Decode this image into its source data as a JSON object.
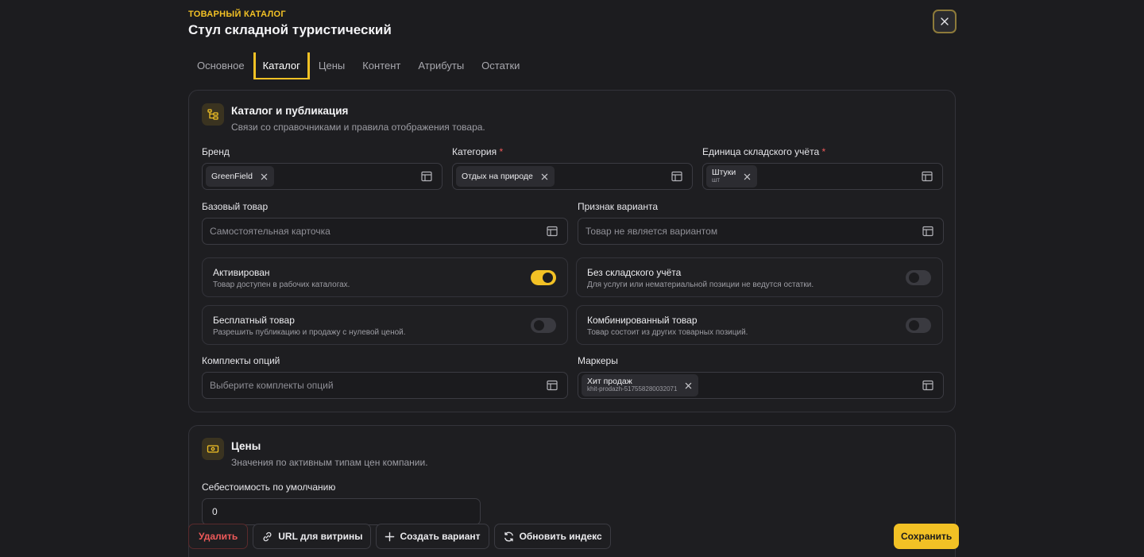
{
  "header": {
    "eyebrow": "ТОВАРНЫЙ КАТАЛОГ",
    "title": "Стул складной туристический"
  },
  "tabs": [
    {
      "label": "Основное",
      "active": false
    },
    {
      "label": "Каталог",
      "active": true
    },
    {
      "label": "Цены",
      "active": false
    },
    {
      "label": "Контент",
      "active": false
    },
    {
      "label": "Атрибуты",
      "active": false
    },
    {
      "label": "Остатки",
      "active": false
    }
  ],
  "catalog": {
    "title": "Каталог и публикация",
    "subtitle": "Связи со справочниками и правила отображения товара.",
    "brand": {
      "label": "Бренд",
      "value": "GreenField"
    },
    "category": {
      "label": "Категория",
      "required": "*",
      "value": "Отдых на природе"
    },
    "unit": {
      "label": "Единица складского учёта",
      "required": "*",
      "value": "Штуки",
      "value_sub": "шт"
    },
    "base_product": {
      "label": "Базовый товар",
      "placeholder": "Самостоятельная карточка"
    },
    "variant_flag": {
      "label": "Признак варианта",
      "placeholder": "Товар не является вариантом"
    },
    "toggles": {
      "active": {
        "title": "Активирован",
        "desc": "Товар доступен в рабочих каталогах.",
        "on": true
      },
      "no_stock": {
        "title": "Без складского учёта",
        "desc": "Для услуги или нематериальной позиции не ведутся остатки.",
        "on": false
      },
      "free": {
        "title": "Бесплатный товар",
        "desc": "Разрешить публикацию и продажу с нулевой ценой.",
        "on": false
      },
      "combo": {
        "title": "Комбинированный товар",
        "desc": "Товар состоит из других товарных позиций.",
        "on": false
      }
    },
    "option_sets": {
      "label": "Комплекты опций",
      "placeholder": "Выберите комплекты опций"
    },
    "markers": {
      "label": "Маркеры",
      "value": "Хит продаж",
      "value_sub": "khit-prodazh-517558280032071"
    }
  },
  "prices": {
    "title": "Цены",
    "subtitle": "Значения по активным типам цен компании.",
    "cost_label": "Себестоимость по умолчанию",
    "cost_value": "0"
  },
  "actions": {
    "delete": "Удалить",
    "url": "URL для витрины",
    "create_variant": "Создать вариант",
    "reindex": "Обновить индекс",
    "save": "Сохранить"
  },
  "colors": {
    "accent": "#f2c125",
    "danger": "#ef5a5a",
    "background": "#1c1c1f"
  }
}
